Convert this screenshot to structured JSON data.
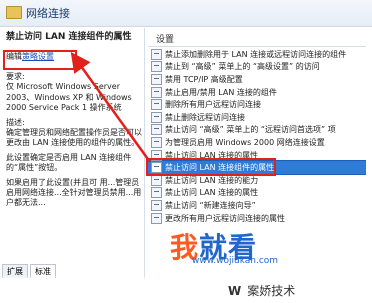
{
  "window": {
    "title": "网络连接"
  },
  "left": {
    "heading": "禁止访问 LAN 连接组件的属性",
    "edit_prefix": "编辑",
    "edit_link": "策略设置",
    "req_label": "要求:",
    "req_text": "仅 Microsoft Windows Server 2003、Windows XP 和 Windows 2000 Service Pack 1 操作系统",
    "desc_label": "描述:",
    "desc_text": "确定管理员和网络配置操作员是否可以更改由 LAN 连接使用的组件的属性。",
    "desc2": "此设置确定是否启用 LAN 连接组件的“属性”按钮。",
    "desc3": "如果启用了此设置(并且可 用...管理员启用网络连接...全针对管理员禁用...用户都无法..."
  },
  "right": {
    "column_header": "设置",
    "items": [
      "禁止添加删除用于 LAN 连接或远程访问连接的组件",
      "禁止到 “高级” 菜单上的 “高级设置” 的访问",
      "禁用 TCP/IP 高级配置",
      "禁止启用/禁用 LAN 连接的组件",
      "删除所有用户远程访问连接",
      "禁止删除远程访问连接",
      "禁止访问 “高级” 菜单上的 “远程访问首选项” 项",
      "为管理员启用 Windows 2000 网络连接设置",
      "禁止访问 LAN 连接的属性",
      "禁止访问 LAN 连接组件的属性",
      "禁止访问 LAN 连接的能力",
      "禁止访问 LAN 连接的属性",
      "禁止访问 “新建连接向导”",
      "更改所有用户远程访问连接的属性"
    ],
    "selected_index": 9
  },
  "tabs": [
    "扩展",
    "标准"
  ],
  "watermark": {
    "text_a": "我",
    "text_b": "就看",
    "url": "www.wojiukan.com"
  },
  "bottom": {
    "logo_text": "案娇技术"
  },
  "colors": {
    "selection": "#2f7bd8",
    "highlight_red": "#e3211b"
  }
}
